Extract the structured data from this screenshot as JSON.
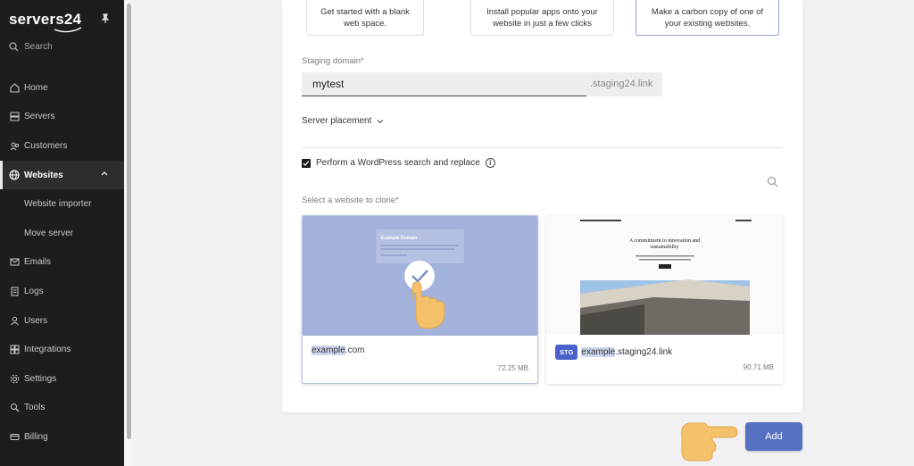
{
  "brand": {
    "name": "servers24"
  },
  "sidebar": {
    "search_label": "Search",
    "items": [
      {
        "label": "Home",
        "icon": "home-icon"
      },
      {
        "label": "Servers",
        "icon": "server-icon"
      },
      {
        "label": "Customers",
        "icon": "customers-icon"
      },
      {
        "label": "Websites",
        "icon": "globe-icon",
        "active": true
      },
      {
        "label": "Website importer",
        "sub": true
      },
      {
        "label": "Move server",
        "sub": true
      },
      {
        "label": "Emails",
        "icon": "mail-icon"
      },
      {
        "label": "Logs",
        "icon": "logs-icon"
      },
      {
        "label": "Users",
        "icon": "users-icon"
      },
      {
        "label": "Integrations",
        "icon": "integrations-icon"
      },
      {
        "label": "Settings",
        "icon": "gear-icon"
      },
      {
        "label": "Tools",
        "icon": "tools-icon"
      },
      {
        "label": "Billing",
        "icon": "billing-icon"
      }
    ]
  },
  "options": {
    "blank": "Get started with a blank web space.",
    "apps": "Install popular apps onto your website in just a few clicks",
    "clone": "Make a carbon copy of one of your existing websites."
  },
  "form": {
    "staging_label": "Staging domain*",
    "staging_value": "mytest",
    "staging_suffix": ".staging24.link",
    "placement_label": "Server placement",
    "wp_replace_label": "Perform a WordPress search and replace",
    "select_label": "Select a website to clone*"
  },
  "sites": [
    {
      "name_highlight": "example",
      "name_rest": ".com",
      "size": "72.25 MB",
      "preview_title": "Example Domain",
      "selected": true
    },
    {
      "badge": "STG",
      "name_highlight": "example",
      "name_rest": ".staging24.link",
      "size": "90.71 MB",
      "preview_heading": "A commitment to innovation and sustainability"
    }
  ],
  "add_label": "Add",
  "colors": {
    "accent": "#5670c2",
    "sidebar_bg": "#1c1d1f",
    "selected_thumb": "#a3b2da"
  }
}
